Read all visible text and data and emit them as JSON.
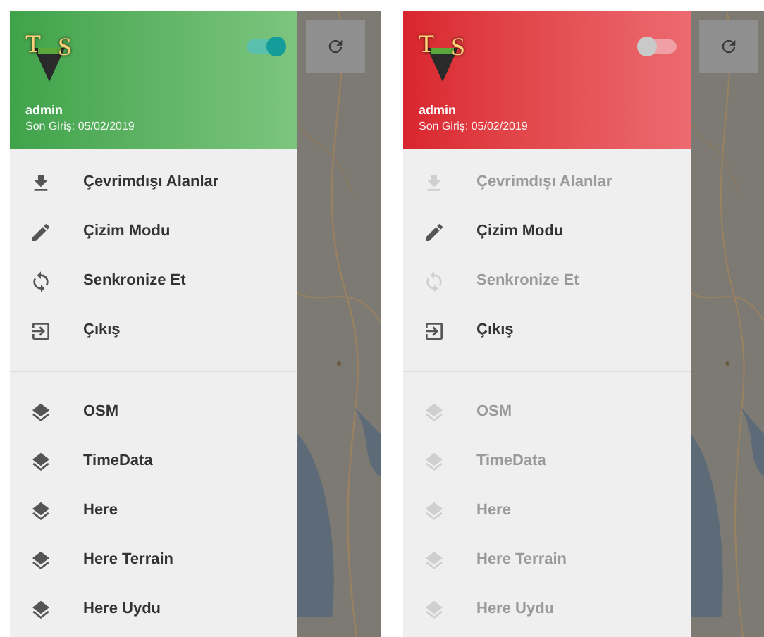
{
  "screens": [
    {
      "online": true,
      "logo": {
        "left": "T",
        "right": "S"
      },
      "user": "admin",
      "last_login": "Son Giriş: 05/02/2019",
      "menu": [
        {
          "label": "Çevrimdışı Alanlar",
          "disabled": false
        },
        {
          "label": "Çizim Modu",
          "disabled": false
        },
        {
          "label": "Senkronize Et",
          "disabled": false
        },
        {
          "label": "Çıkış",
          "disabled": false
        }
      ],
      "layers": [
        {
          "label": "OSM",
          "disabled": false
        },
        {
          "label": "TimeData",
          "disabled": false
        },
        {
          "label": "Here",
          "disabled": false
        },
        {
          "label": "Here Terrain",
          "disabled": false
        },
        {
          "label": "Here Uydu",
          "disabled": false
        }
      ]
    },
    {
      "online": false,
      "logo": {
        "left": "T",
        "right": "S"
      },
      "user": "admin",
      "last_login": "Son Giriş: 05/02/2019",
      "menu": [
        {
          "label": "Çevrimdışı Alanlar",
          "disabled": true
        },
        {
          "label": "Çizim Modu",
          "disabled": false
        },
        {
          "label": "Senkronize Et",
          "disabled": true
        },
        {
          "label": "Çıkış",
          "disabled": false
        }
      ],
      "layers": [
        {
          "label": "OSM",
          "disabled": true
        },
        {
          "label": "TimeData",
          "disabled": true
        },
        {
          "label": "Here",
          "disabled": true
        },
        {
          "label": "Here Terrain",
          "disabled": true
        },
        {
          "label": "Here Uydu",
          "disabled": true
        }
      ]
    }
  ]
}
